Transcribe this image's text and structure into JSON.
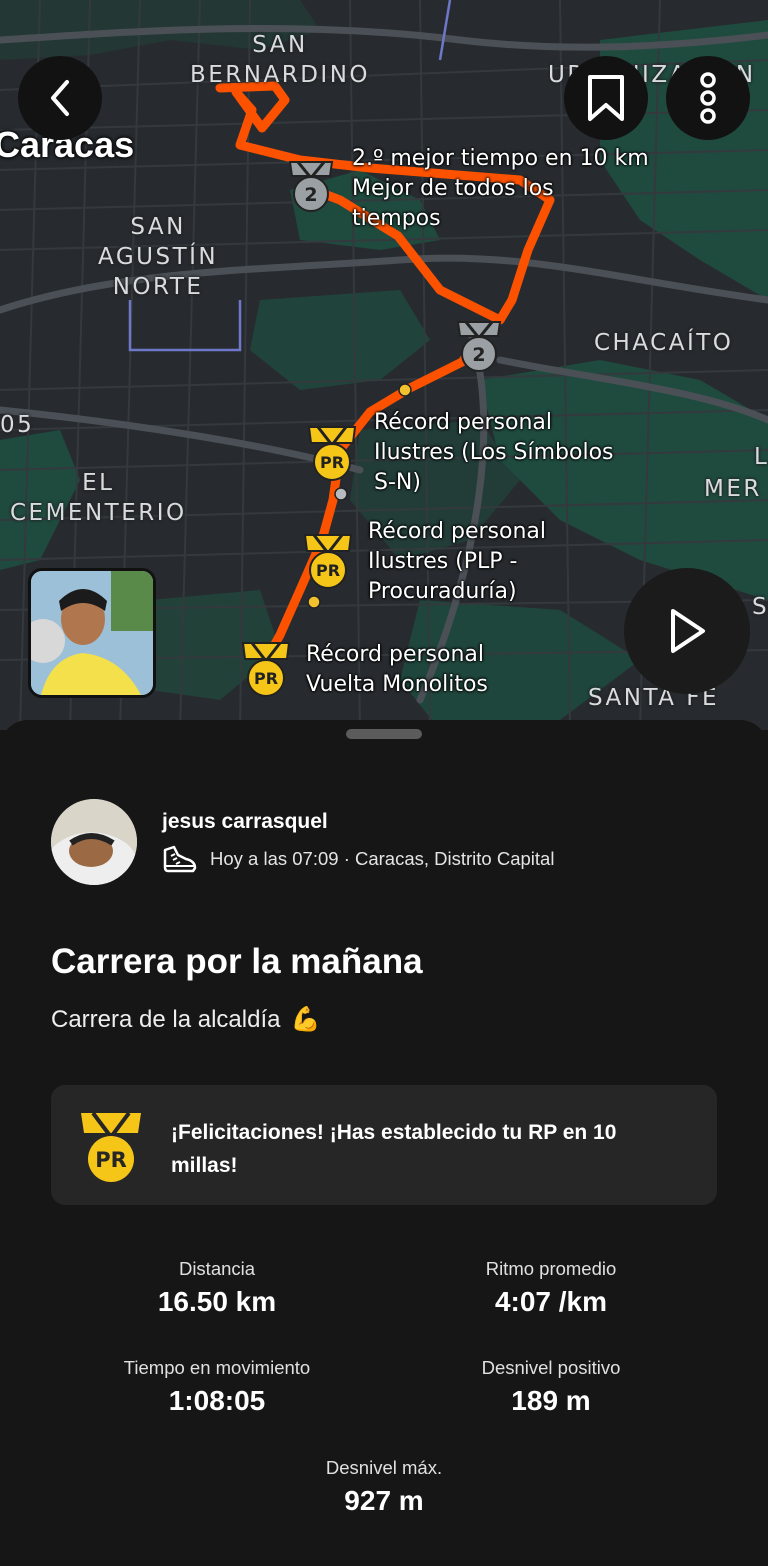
{
  "map": {
    "city": "Caracas",
    "places": [
      "SAN\nBERNARDINO",
      "SAN\nAGUSTÍN\nNORTE",
      "CHACAÍTO",
      "EL\nCEMENTERIO",
      "SANTA FE",
      "URBANIZACIÓN",
      "MER",
      "05",
      "S",
      "L"
    ],
    "segments": [
      {
        "rank": "2",
        "text": "2.º mejor tiempo en 10 km\nMejor de todos los\ntiempos"
      },
      {
        "rank": "PR",
        "text": "Récord personal\nIlustres (Los Símbolos\nS-N)"
      },
      {
        "rank": "PR",
        "text": "Récord personal\nIlustres (PLP -\nProcuraduría)"
      },
      {
        "rank": "PR",
        "text": "Récord personal\nVuelta Monolitos"
      }
    ],
    "medal_second": "2",
    "medal_pr": "PR",
    "route_color": "#fc5200",
    "icons": {
      "back": "chevron-left-icon",
      "bookmark": "bookmark-icon",
      "more": "more-vertical-icon",
      "play": "play-icon"
    }
  },
  "activity": {
    "user": "jesus carrasquel",
    "meta": "Hoy a las 07:09 · Caracas, Distrito Capital",
    "title": "Carrera por la mañana",
    "description": "Carrera de la alcaldía",
    "description_emoji": "💪",
    "pr_badge": "PR",
    "pr_message": "¡Felicitaciones! ¡Has establecido tu RP en 10 millas!"
  },
  "stats": [
    {
      "label": "Distancia",
      "value": "16.50 km"
    },
    {
      "label": "Ritmo promedio",
      "value": "4:07 /km"
    },
    {
      "label": "Tiempo en movimiento",
      "value": "1:08:05"
    },
    {
      "label": "Desnivel positivo",
      "value": "189 m"
    },
    {
      "label": "Desnivel máx.",
      "value": "927 m"
    }
  ],
  "colors": {
    "medal_gold": "#f5c518",
    "medal_silver": "#9aa0a3",
    "sheet_bg": "#161616",
    "card_bg": "#262626"
  }
}
